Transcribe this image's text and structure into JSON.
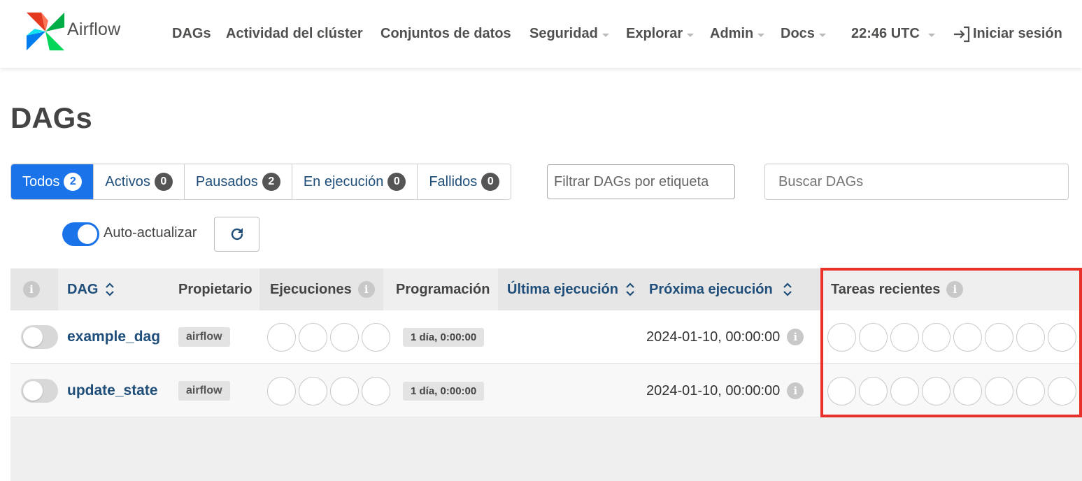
{
  "brand": {
    "name": "Airflow"
  },
  "nav": {
    "dags": "DAGs",
    "cluster_activity": "Actividad del clúster",
    "datasets": "Conjuntos de datos",
    "security": "Seguridad",
    "browse": "Explorar",
    "admin": "Admin",
    "docs": "Docs",
    "clock": "22:46 UTC",
    "login": "Iniciar sesión"
  },
  "page": {
    "title": "DAGs"
  },
  "filters": {
    "status": [
      {
        "label": "Todos",
        "count": "2",
        "active": true
      },
      {
        "label": "Activos",
        "count": "0",
        "active": false
      },
      {
        "label": "Pausados",
        "count": "2",
        "active": false
      },
      {
        "label": "En ejecución",
        "count": "0",
        "active": false
      },
      {
        "label": "Fallidos",
        "count": "0",
        "active": false
      }
    ],
    "tag_placeholder": "Filtrar DAGs por etiqueta",
    "search_placeholder": "Buscar DAGs"
  },
  "auto_refresh": {
    "label": "Auto-actualizar",
    "enabled": true
  },
  "table": {
    "headers": {
      "dag": "DAG",
      "owner": "Propietario",
      "runs": "Ejecuciones",
      "schedule": "Programación",
      "last_run": "Última ejecución",
      "next_run": "Próxima ejecución",
      "recent_tasks": "Tareas recientes"
    },
    "info_glyph": "i",
    "rows": [
      {
        "name": "example_dag",
        "owner": "airflow",
        "schedule": "1 día, 0:00:00",
        "next_run": "2024-01-10, 00:00:00"
      },
      {
        "name": "update_state",
        "owner": "airflow",
        "schedule": "1 día, 0:00:00",
        "next_run": "2024-01-10, 00:00:00"
      }
    ]
  },
  "colors": {
    "primary": "#1a73e8",
    "link": "#1e4e79",
    "highlight": "#e8312a"
  }
}
